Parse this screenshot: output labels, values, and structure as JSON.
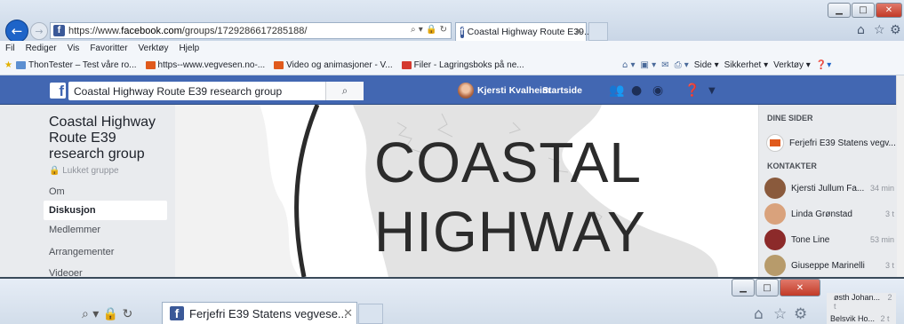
{
  "browser": {
    "url_prefix": "https://www.",
    "url_domain": "facebook.com",
    "url_path": "/groups/1729286617285188/",
    "tab_title": "Coastal Highway Route E39...",
    "menu": [
      "Fil",
      "Rediger",
      "Vis",
      "Favoritter",
      "Verktøy",
      "Hjelp"
    ],
    "favorites": [
      {
        "label": "ThonTester – Test våre ro...",
        "color": "#5b8fd1"
      },
      {
        "label": "https--www.vegvesen.no-...",
        "color": "#e05a1c"
      },
      {
        "label": "Video og animasjoner - V...",
        "color": "#e05a1c"
      },
      {
        "label": "Filer - Lagringsboks på ne...",
        "color": "#d43a2f"
      }
    ],
    "commands": [
      "Side ▾",
      "Sikkerhet ▾",
      "Verktøy ▾"
    ]
  },
  "facebook": {
    "search_value": "Coastal Highway Route E39 research group",
    "user_name": "Kjersti Kvalheim",
    "home_label": "Startside"
  },
  "group": {
    "title": "Coastal Highway Route E39 research group",
    "privacy": "Lukket gruppe",
    "nav": [
      "Om",
      "Diskusjon",
      "Medlemmer",
      "Arrangementer",
      "Videoer"
    ],
    "active_nav": "Diskusjon"
  },
  "cover": {
    "line1": "COASTAL",
    "line2": "HIGHWAY"
  },
  "sidebar": {
    "pages_heading": "DINE SIDER",
    "page_item": "Ferjefri E39 Statens vegv...",
    "contacts_heading": "KONTAKTER",
    "contacts": [
      {
        "name": "Kjersti Jullum Fa...",
        "time": "34 min",
        "color": "#8a5a3c"
      },
      {
        "name": "Linda Grønstad",
        "time": "3 t",
        "color": "#d9a27c"
      },
      {
        "name": "Tone Line",
        "time": "53 min",
        "color": "#8c2a2a"
      },
      {
        "name": "Giuseppe Marinelli",
        "time": "3 t",
        "color": "#b79b6b"
      },
      {
        "name": "østh Johan...",
        "time": "2 t",
        "color": "#a08878"
      },
      {
        "name": "Belsvik Ho...",
        "time": "2 t",
        "color": "#8a7a6a"
      }
    ]
  },
  "window2": {
    "tab_title": "Ferjefri E39 Statens vegvese..."
  }
}
